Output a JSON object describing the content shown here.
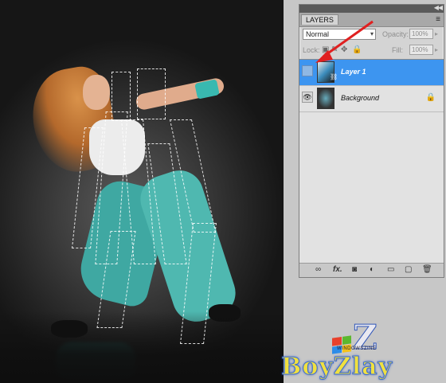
{
  "panel": {
    "title": "LAYERS",
    "collapse_icon": "double-chevron-icon",
    "menu_icon": "panel-menu-icon",
    "blend_mode": "Normal",
    "opacity_label": "Opacity:",
    "opacity_value": "100%",
    "lock_label": "Lock:",
    "fill_label": "Fill:",
    "fill_value": "100%"
  },
  "layers": [
    {
      "name": "Layer 1",
      "selected": true,
      "visible": false
    },
    {
      "name": "Background",
      "selected": false,
      "visible": true,
      "locked": true
    }
  ],
  "bottom_icons": [
    "link-icon",
    "fx-icon",
    "mask-icon",
    "adjustment-icon",
    "folder-icon",
    "new-layer-icon",
    "trash-icon"
  ],
  "bottom_glyphs": {
    "link": "∞",
    "fx": "fx.",
    "mask": "◙",
    "adjust": "◐",
    "folder": "▭",
    "new": "▢",
    "trash": "🗑"
  },
  "watermark": {
    "text": "BoyZlay",
    "sub": "WINDOWSZINE"
  },
  "colors": {
    "selected_layer": "#3d95f0",
    "arrow": "#e02020"
  }
}
